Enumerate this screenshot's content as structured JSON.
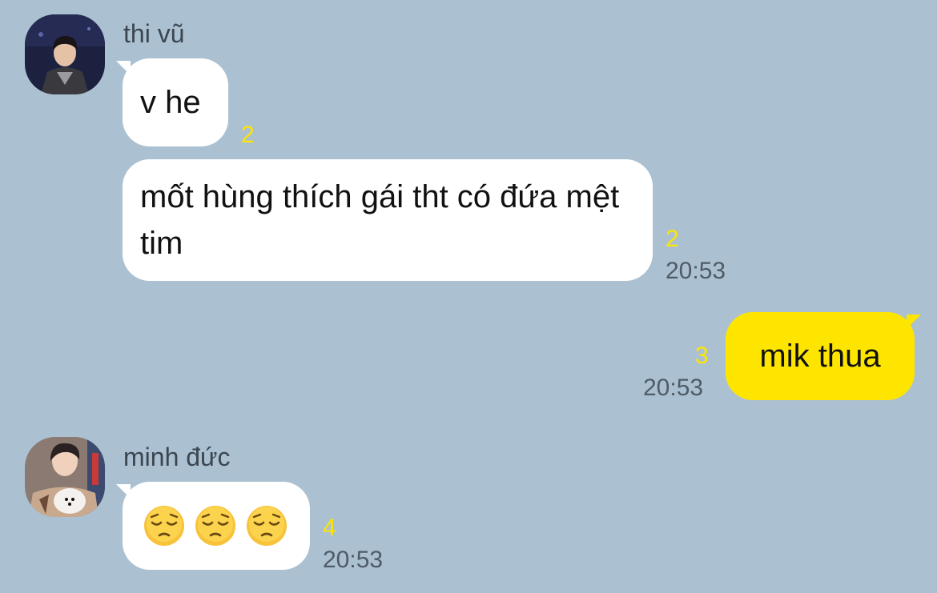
{
  "messages": [
    {
      "sender": "thi vũ",
      "avatar_icon": "person-photo-icon",
      "items": [
        {
          "text": "v he",
          "unread": "2"
        },
        {
          "text": "mốt hùng thích gái tht có đứa mệt tim",
          "unread": "2",
          "time": "20:53"
        }
      ]
    },
    {
      "sender": "me",
      "items": [
        {
          "text": "mik thua",
          "unread": "3",
          "time": "20:53"
        }
      ]
    },
    {
      "sender": "minh đức",
      "avatar_icon": "person-with-dog-photo-icon",
      "items": [
        {
          "emojis": [
            "pensive-face-icon",
            "pensive-face-icon",
            "pensive-face-icon"
          ],
          "unread": "4",
          "time": "20:53"
        }
      ]
    }
  ],
  "colors": {
    "background": "#abc1d2",
    "incoming_bubble": "#ffffff",
    "outgoing_bubble": "#fee500",
    "unread_count": "#fee500",
    "timestamp": "#4f5b66",
    "sender_name": "#3c4651"
  }
}
